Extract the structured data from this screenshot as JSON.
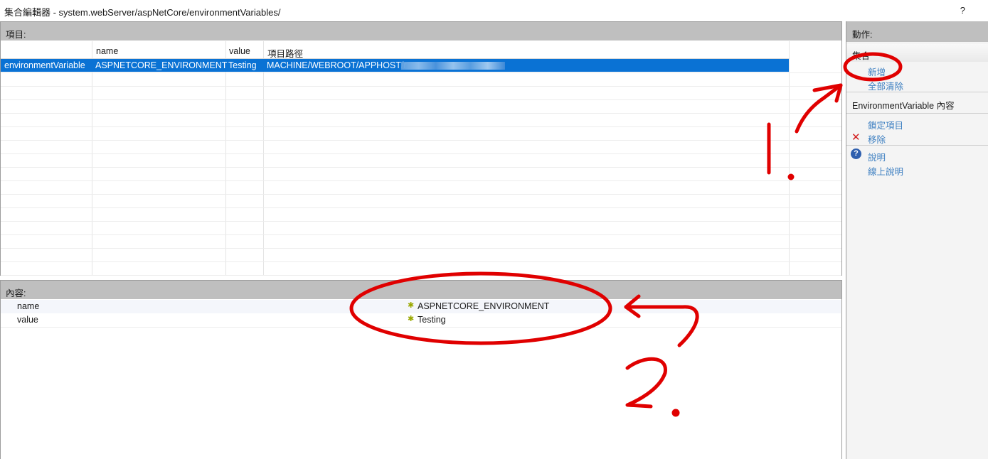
{
  "window": {
    "title": "集合編輯器 - system.webServer/aspNetCore/environmentVariables/",
    "help": "?"
  },
  "items": {
    "header": "項目:",
    "columns": [
      "name",
      "value",
      "項目路徑"
    ],
    "selected_row": {
      "type": "environmentVariable",
      "name": "ASPNETCORE_ENVIRONMENT",
      "value": "Testing",
      "path": "MACHINE/WEBROOT/APPHOST/r"
    }
  },
  "properties": {
    "header": "內容:",
    "rows": [
      {
        "label": "name",
        "value": "ASPNETCORE_ENVIRONMENT"
      },
      {
        "label": "value",
        "value": "Testing"
      }
    ]
  },
  "actions": {
    "header": "動作:",
    "collection_group": "集合",
    "add": "新增",
    "clear_all": "全部清除",
    "item_group": "EnvironmentVariable 內容",
    "lock_item": "鎖定項目",
    "remove": "移除",
    "help": "說明",
    "online_help": "線上說明"
  },
  "colors": {
    "selection": "#0a72d4",
    "link": "#3d7fc1",
    "annotation": "#e00000"
  }
}
